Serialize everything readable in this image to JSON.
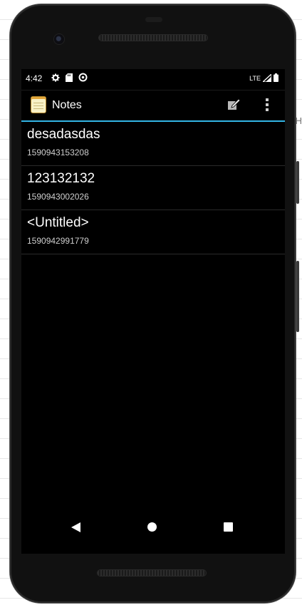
{
  "background": {
    "hint_text": "H"
  },
  "status_bar": {
    "time": "4:42",
    "network_label": "LTE",
    "icons": [
      "gear-icon",
      "sd-card-icon",
      "data-saver-icon",
      "signal-icon",
      "battery-icon"
    ]
  },
  "action_bar": {
    "title": "Notes",
    "icons": [
      "notepad-app-icon",
      "new-note-icon",
      "overflow-menu-icon"
    ],
    "accent_color": "#33b5e5"
  },
  "notes": [
    {
      "title": "desadasdas",
      "timestamp": "1590943153208"
    },
    {
      "title": "123132132",
      "timestamp": "1590943002026"
    },
    {
      "title": "<Untitled>",
      "timestamp": "1590942991779"
    }
  ],
  "navigation": {
    "icons": [
      "back-icon",
      "home-icon",
      "recents-icon"
    ]
  },
  "colors": {
    "screen_background": "#000000",
    "text_primary": "#ffffff",
    "text_secondary": "#cfcfcf",
    "divider": "#2a2a2a"
  }
}
